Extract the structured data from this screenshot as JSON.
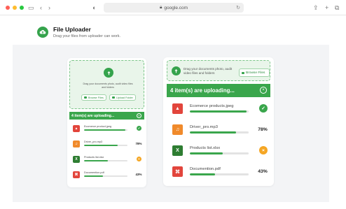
{
  "browser": {
    "url": "google.com",
    "lock_icon": "lock-icon"
  },
  "app": {
    "title": "File Uploader",
    "subtitle": "Drag your files from uploader can work."
  },
  "colors": {
    "accent": "#3aa64c",
    "warning": "#f5a623"
  },
  "small_card": {
    "drop_text": "Drag your documents photo, audit video files and folders",
    "browse_label": "Browse Files",
    "folder_label": "Upload Folder",
    "header": "4 item(s) are uploading...",
    "files": [
      {
        "name": "Ecomerce product.jpeg",
        "type": "image",
        "color": "#e2453c",
        "progress": 0.95,
        "status": "done",
        "status_text": ""
      },
      {
        "name": "Driver_pro.mp3",
        "type": "audio",
        "color": "#f08a2b",
        "progress": 0.78,
        "status": "percent",
        "status_text": "78%"
      },
      {
        "name": "Products list.xlsx",
        "type": "excel",
        "color": "#2e7d32",
        "progress": 0.55,
        "status": "error",
        "status_text": ""
      },
      {
        "name": "Documention.pdf",
        "type": "pdf",
        "color": "#e2453c",
        "progress": 0.43,
        "status": "percent",
        "status_text": "43%"
      }
    ]
  },
  "big_card": {
    "drop_text": "Drag your documents photo, audit video files and folders",
    "browse_label": "Browse Files",
    "header": "4 item(s) are uploading...",
    "files": [
      {
        "name": "Ecomerce products.jpeg",
        "type": "image",
        "color": "#e2453c",
        "progress": 0.97,
        "status": "done",
        "status_text": ""
      },
      {
        "name": "Driver_pro.mp3",
        "type": "audio",
        "color": "#f08a2b",
        "progress": 0.78,
        "status": "percent",
        "status_text": "78%"
      },
      {
        "name": "Products list.xlsx",
        "type": "excel",
        "color": "#2e7d32",
        "progress": 0.56,
        "status": "error",
        "status_text": ""
      },
      {
        "name": "Documention.pdf",
        "type": "pdf",
        "color": "#e2453c",
        "progress": 0.43,
        "status": "percent",
        "status_text": "43%"
      }
    ]
  }
}
